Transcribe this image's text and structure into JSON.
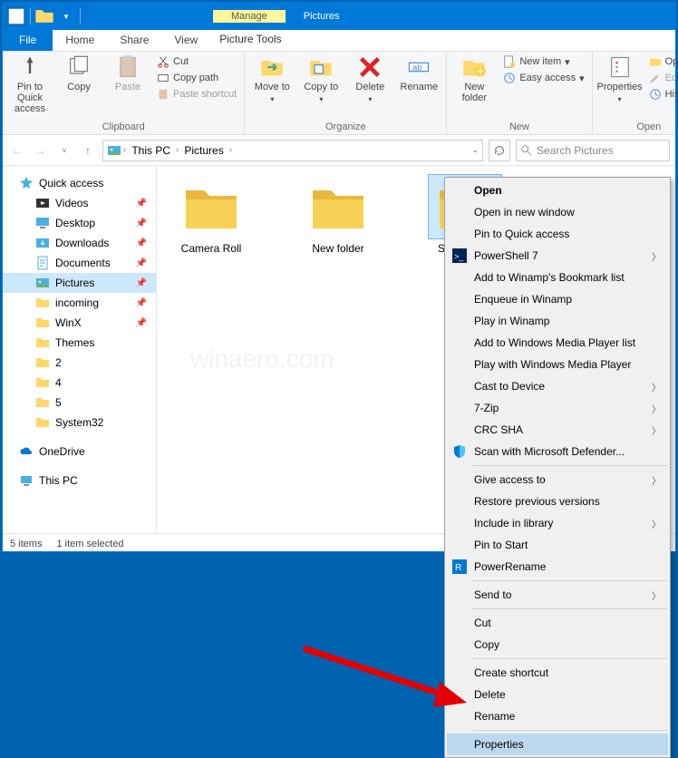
{
  "title_context_tabs": [
    {
      "group": "Manage",
      "sub": "Picture Tools",
      "style": "yellow"
    },
    {
      "group": "Pictures",
      "sub": "",
      "style": "purple"
    }
  ],
  "menubar": {
    "file": "File",
    "tabs": [
      "Home",
      "Share",
      "View"
    ]
  },
  "ribbon": {
    "clipboard": {
      "label": "Clipboard",
      "pin": "Pin to Quick access",
      "copy": "Copy",
      "paste": "Paste",
      "cut": "Cut",
      "copy_path": "Copy path",
      "paste_shortcut": "Paste shortcut"
    },
    "organize": {
      "label": "Organize",
      "move_to": "Move to",
      "copy_to": "Copy to",
      "delete": "Delete",
      "rename": "Rename"
    },
    "new": {
      "label": "New",
      "new_folder": "New folder",
      "new_item": "New item",
      "easy_access": "Easy access"
    },
    "open": {
      "label": "Open",
      "properties": "Properties",
      "open": "Open",
      "edit": "Edit",
      "history": "History"
    }
  },
  "breadcrumb": [
    "This PC",
    "Pictures"
  ],
  "search_placeholder": "Search Pictures",
  "sidebar": {
    "quick_access": "Quick access",
    "items": [
      {
        "label": "Videos",
        "icon": "video",
        "pin": true
      },
      {
        "label": "Desktop",
        "icon": "desktop",
        "pin": true
      },
      {
        "label": "Downloads",
        "icon": "download",
        "pin": true
      },
      {
        "label": "Documents",
        "icon": "doc",
        "pin": true
      },
      {
        "label": "Pictures",
        "icon": "pic",
        "pin": true,
        "selected": true
      },
      {
        "label": "incoming",
        "icon": "folder",
        "pin": true
      },
      {
        "label": "WinX",
        "icon": "folder",
        "pin": true
      },
      {
        "label": "Themes",
        "icon": "folder",
        "pin": false
      },
      {
        "label": "2",
        "icon": "folder",
        "pin": false
      },
      {
        "label": "4",
        "icon": "folder",
        "pin": false
      },
      {
        "label": "5",
        "icon": "folder",
        "pin": false
      },
      {
        "label": "System32",
        "icon": "folder",
        "pin": false
      }
    ],
    "onedrive": "OneDrive",
    "this_pc": "This PC"
  },
  "folders": [
    {
      "label": "Camera Roll",
      "selected": false
    },
    {
      "label": "New folder",
      "selected": false
    },
    {
      "label": "Saved Pi…",
      "selected": true
    }
  ],
  "statusbar": {
    "count": "5 items",
    "selection": "1 item selected"
  },
  "context_menu": [
    {
      "type": "item",
      "label": "Open",
      "bold": true
    },
    {
      "type": "item",
      "label": "Open in new window"
    },
    {
      "type": "item",
      "label": "Pin to Quick access"
    },
    {
      "type": "item",
      "label": "PowerShell 7",
      "submenu": true,
      "icon": "ps"
    },
    {
      "type": "item",
      "label": "Add to Winamp's Bookmark list"
    },
    {
      "type": "item",
      "label": "Enqueue in Winamp"
    },
    {
      "type": "item",
      "label": "Play in Winamp"
    },
    {
      "type": "item",
      "label": "Add to Windows Media Player list"
    },
    {
      "type": "item",
      "label": "Play with Windows Media Player"
    },
    {
      "type": "item",
      "label": "Cast to Device",
      "submenu": true
    },
    {
      "type": "item",
      "label": "7-Zip",
      "submenu": true
    },
    {
      "type": "item",
      "label": "CRC SHA",
      "submenu": true
    },
    {
      "type": "item",
      "label": "Scan with Microsoft Defender...",
      "icon": "shield"
    },
    {
      "type": "sep"
    },
    {
      "type": "item",
      "label": "Give access to",
      "submenu": true
    },
    {
      "type": "item",
      "label": "Restore previous versions"
    },
    {
      "type": "item",
      "label": "Include in library",
      "submenu": true
    },
    {
      "type": "item",
      "label": "Pin to Start"
    },
    {
      "type": "item",
      "label": "PowerRename",
      "icon": "pr"
    },
    {
      "type": "sep"
    },
    {
      "type": "item",
      "label": "Send to",
      "submenu": true
    },
    {
      "type": "sep"
    },
    {
      "type": "item",
      "label": "Cut"
    },
    {
      "type": "item",
      "label": "Copy"
    },
    {
      "type": "sep"
    },
    {
      "type": "item",
      "label": "Create shortcut"
    },
    {
      "type": "item",
      "label": "Delete"
    },
    {
      "type": "item",
      "label": "Rename"
    },
    {
      "type": "sep"
    },
    {
      "type": "item",
      "label": "Properties",
      "highlighted": true
    }
  ],
  "watermark": "winaero.com"
}
